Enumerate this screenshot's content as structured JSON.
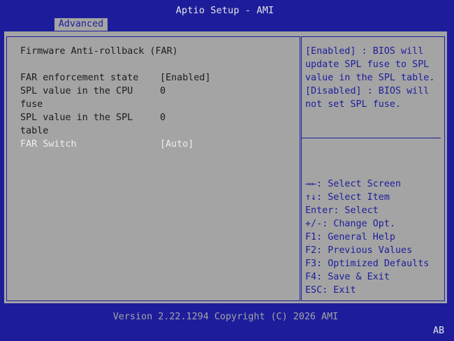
{
  "window": {
    "title": "Aptio Setup - AMI"
  },
  "tabs": [
    {
      "label": "Advanced",
      "active": true
    }
  ],
  "main": {
    "section_title": "Firmware Anti-rollback (FAR)",
    "settings": [
      {
        "label": "FAR enforcement state",
        "value": "[Enabled]"
      },
      {
        "label_line1": "SPL value in the CPU",
        "label_line2": "fuse",
        "value": "0"
      },
      {
        "label_line1": "SPL value in the SPL",
        "label_line2": "table",
        "value": "0"
      },
      {
        "label": "FAR Switch",
        "value": "[Auto]",
        "selected": true
      }
    ]
  },
  "help": {
    "description": [
      "[Enabled] : BIOS will",
      "update SPL fuse to SPL",
      "value in the SPL table.",
      "[Disabled] : BIOS will",
      "not set SPL fuse."
    ],
    "keys": [
      {
        "key": "→←",
        "text": ": Select Screen"
      },
      {
        "key": "↑↓",
        "text": ": Select Item"
      },
      {
        "key": "Enter",
        "text": ": Select"
      },
      {
        "key": "+/-",
        "text": ": Change Opt."
      },
      {
        "key": "F1",
        "text": ": General Help"
      },
      {
        "key": "F2",
        "text": ": Previous Values"
      },
      {
        "key": "F3",
        "text": ": Optimized Defaults"
      },
      {
        "key": "F4",
        "text": ": Save & Exit"
      },
      {
        "key": "ESC",
        "text": ": Exit"
      }
    ]
  },
  "footer": {
    "version_text": "Version 2.22.1294 Copyright (C) 2026 AMI",
    "corner_code": "AB"
  },
  "colors": {
    "background": "#1d1d9c",
    "panel": "#a4a4a4",
    "selected_text": "#eeeeee",
    "help_text": "#1d1d9c"
  }
}
